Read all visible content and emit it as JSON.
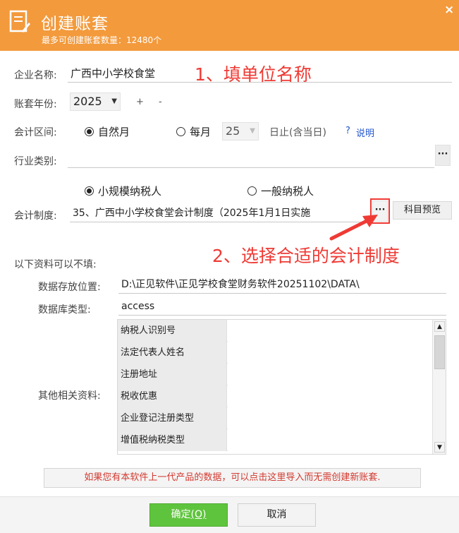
{
  "header": {
    "title": "创建账套",
    "subtitle": "最多可创建账套数量：12480个",
    "close": "×"
  },
  "form": {
    "company_label": "企业名称:",
    "company_value": "广西中小学校食堂",
    "year_label": "账套年份:",
    "year_value": "2025",
    "year_plus": "+",
    "year_minus": "-",
    "period_label": "会计区间:",
    "period_natural": "自然月",
    "period_monthly": "每月",
    "period_day": "25",
    "period_suffix": "日止(含当日)",
    "help_q": "?",
    "help_link": "说明",
    "industry_label": "行业类别:",
    "industry_value": "",
    "taxpayer_small": "小规模纳税人",
    "taxpayer_general": "一般纳税人",
    "system_label": "会计制度:",
    "system_value": "35、广西中小学校食堂会计制度（2025年1月1日实施",
    "dots": "···",
    "preview_button": "科目预览",
    "optional_heading": "以下资料可以不填:",
    "storage_label": "数据存放位置:",
    "storage_value": "D:\\正见软件\\正见学校食堂财务软件20251102\\DATA\\",
    "dbtype_label": "数据库类型:",
    "dbtype_value": "access",
    "other_label": "其他相关资料:"
  },
  "info_rows": [
    {
      "label": "纳税人识别号",
      "value": ""
    },
    {
      "label": "法定代表人姓名",
      "value": ""
    },
    {
      "label": "注册地址",
      "value": ""
    },
    {
      "label": "税收优惠",
      "value": ""
    },
    {
      "label": "企业登记注册类型",
      "value": ""
    },
    {
      "label": "增值税纳税类型",
      "value": ""
    }
  ],
  "annotations": {
    "step1": "1、填单位名称",
    "step2": "2、选择合适的会计制度",
    "accent_color": "#ef3a34"
  },
  "import_text": "如果您有本软件上一代产品的数据，可以点击这里导入而无需创建新账套.",
  "footer": {
    "ok_label": "确定",
    "ok_shortcut": "(O)",
    "cancel_label": "取消"
  },
  "colors": {
    "header_bg": "#f39a3c",
    "ok_bg": "#5fc43d"
  }
}
